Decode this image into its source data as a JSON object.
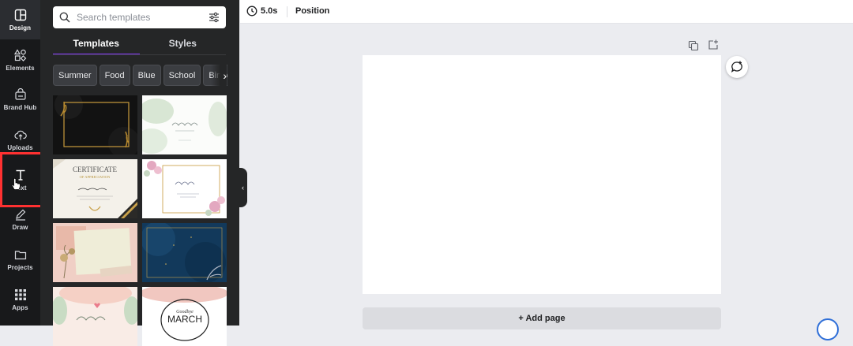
{
  "rail": {
    "items": [
      {
        "label": "Design",
        "icon": "layout-icon"
      },
      {
        "label": "Elements",
        "icon": "shapes-icon"
      },
      {
        "label": "Brand Hub",
        "icon": "brand-hub-icon"
      },
      {
        "label": "Uploads",
        "icon": "cloud-upload-icon"
      },
      {
        "label": "Text",
        "icon": "text-t-icon"
      },
      {
        "label": "Draw",
        "icon": "pen-icon"
      },
      {
        "label": "Projects",
        "icon": "folder-icon"
      },
      {
        "label": "Apps",
        "icon": "grid-icon"
      }
    ]
  },
  "panel": {
    "search_placeholder": "Search templates",
    "tabs": [
      {
        "label": "Templates"
      },
      {
        "label": "Styles"
      }
    ],
    "chips": [
      {
        "label": "Summer"
      },
      {
        "label": "Food"
      },
      {
        "label": "Blue"
      },
      {
        "label": "School"
      },
      {
        "label": "Birthday"
      }
    ],
    "thumbnails": {
      "cert_title": "CERTIFICATE",
      "cert_sub": "OF APPRECIATION",
      "march_small": "Goodbye",
      "march_big": "MARCH"
    }
  },
  "topbar": {
    "duration": "5.0s",
    "position_label": "Position"
  },
  "canvas": {
    "add_page_label": "+ Add page"
  },
  "colors": {
    "accent": "#8b3dff",
    "highlight": "#ff3131"
  }
}
